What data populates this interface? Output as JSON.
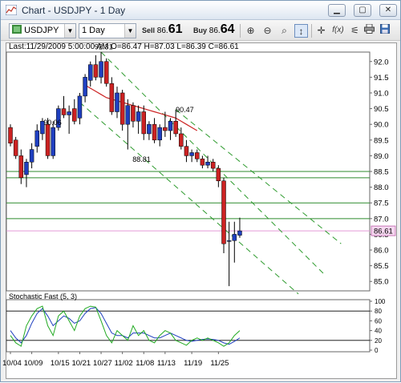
{
  "window": {
    "title": "Chart - USDJPY - 1 Day",
    "controls": [
      "minimize",
      "maximize",
      "close"
    ]
  },
  "toolbar": {
    "symbol": "USDJPY",
    "period": "1 Day",
    "sell_label": "Sell",
    "sell_small": "86.",
    "sell_big": "61",
    "buy_label": "Buy",
    "buy_small": "86.",
    "buy_big": "64",
    "tools": [
      "zoom-in-icon",
      "zoom-out-icon",
      "zoom-area-icon",
      "zoom-reset-icon",
      "cursor-tool-icon",
      "crosshair-icon",
      "fx-icon",
      "indicator-icon",
      "print-icon",
      "save-icon"
    ]
  },
  "chart_header": {
    "last_line": "Last:11/29/2009 5:00:00 AM O=86.47 H=87.03 L=86.39 C=86.61"
  },
  "stochastic": {
    "label": "Stochastic Fast (5, 3)",
    "ticks": [
      "100",
      "80",
      "60",
      "40",
      "20",
      "0"
    ]
  },
  "chart_data": {
    "type": "candlestick",
    "ylim": [
      84.7,
      92.3
    ],
    "y_ticks": [
      "92.0",
      "91.5",
      "91.0",
      "90.5",
      "90.0",
      "89.5",
      "89.0",
      "88.5",
      "88.0",
      "87.5",
      "87.0",
      "86.5",
      "86.0",
      "85.5",
      "85.0"
    ],
    "x_ticks": [
      "10/04",
      "10/09",
      "10/15",
      "10/21",
      "10/27",
      "11/02",
      "11/08",
      "11/13",
      "11/19",
      "11/25"
    ],
    "current_price": "86.61",
    "annotations": [
      "92.31",
      "90.06",
      "90.47",
      "88.81"
    ],
    "horizontal_lines": [
      88.5,
      88.3,
      87.5,
      87.0
    ],
    "candles": [
      {
        "o": 89.9,
        "h": 90.0,
        "l": 89.3,
        "c": 89.4
      },
      {
        "o": 89.5,
        "h": 89.6,
        "l": 88.9,
        "c": 89.0
      },
      {
        "o": 89.0,
        "h": 89.2,
        "l": 88.1,
        "c": 88.3
      },
      {
        "o": 88.4,
        "h": 88.9,
        "l": 88.0,
        "c": 88.8
      },
      {
        "o": 88.8,
        "h": 89.4,
        "l": 88.6,
        "c": 89.2
      },
      {
        "o": 89.3,
        "h": 90.0,
        "l": 89.1,
        "c": 89.8
      },
      {
        "o": 89.7,
        "h": 90.2,
        "l": 89.5,
        "c": 90.1
      },
      {
        "o": 90.0,
        "h": 90.2,
        "l": 88.9,
        "c": 89.0
      },
      {
        "o": 89.0,
        "h": 90.1,
        "l": 88.9,
        "c": 89.9
      },
      {
        "o": 89.9,
        "h": 90.6,
        "l": 89.8,
        "c": 90.5
      },
      {
        "o": 90.5,
        "h": 90.9,
        "l": 90.2,
        "c": 90.3
      },
      {
        "o": 90.3,
        "h": 90.6,
        "l": 89.7,
        "c": 90.4
      },
      {
        "o": 90.5,
        "h": 90.8,
        "l": 90.0,
        "c": 90.1
      },
      {
        "o": 90.2,
        "h": 91.0,
        "l": 90.0,
        "c": 90.9
      },
      {
        "o": 90.9,
        "h": 91.6,
        "l": 90.7,
        "c": 91.5
      },
      {
        "o": 91.4,
        "h": 92.0,
        "l": 91.2,
        "c": 91.9
      },
      {
        "o": 91.9,
        "h": 92.2,
        "l": 91.4,
        "c": 91.5
      },
      {
        "o": 91.5,
        "h": 92.3,
        "l": 91.3,
        "c": 92.0
      },
      {
        "o": 92.0,
        "h": 92.1,
        "l": 91.2,
        "c": 91.3
      },
      {
        "o": 91.3,
        "h": 91.5,
        "l": 90.3,
        "c": 90.4
      },
      {
        "o": 90.4,
        "h": 91.2,
        "l": 90.2,
        "c": 91.0
      },
      {
        "o": 91.0,
        "h": 91.1,
        "l": 89.8,
        "c": 90.0
      },
      {
        "o": 90.0,
        "h": 90.8,
        "l": 89.2,
        "c": 90.6
      },
      {
        "o": 90.6,
        "h": 90.7,
        "l": 89.9,
        "c": 90.1
      },
      {
        "o": 90.1,
        "h": 90.6,
        "l": 89.7,
        "c": 90.4
      },
      {
        "o": 90.4,
        "h": 90.6,
        "l": 89.5,
        "c": 89.7
      },
      {
        "o": 89.7,
        "h": 90.1,
        "l": 89.5,
        "c": 90.0
      },
      {
        "o": 90.0,
        "h": 90.2,
        "l": 89.4,
        "c": 89.5
      },
      {
        "o": 89.5,
        "h": 90.0,
        "l": 89.3,
        "c": 89.9
      },
      {
        "o": 89.9,
        "h": 90.4,
        "l": 89.6,
        "c": 89.8
      },
      {
        "o": 89.8,
        "h": 90.2,
        "l": 89.5,
        "c": 90.1
      },
      {
        "o": 90.1,
        "h": 90.47,
        "l": 89.6,
        "c": 89.7
      },
      {
        "o": 89.7,
        "h": 89.9,
        "l": 89.2,
        "c": 89.3
      },
      {
        "o": 89.3,
        "h": 89.5,
        "l": 88.8,
        "c": 89.0
      },
      {
        "o": 89.0,
        "h": 89.2,
        "l": 88.8,
        "c": 89.1
      },
      {
        "o": 89.1,
        "h": 89.2,
        "l": 88.8,
        "c": 88.9
      },
      {
        "o": 88.9,
        "h": 89.0,
        "l": 88.6,
        "c": 88.7
      },
      {
        "o": 88.7,
        "h": 89.0,
        "l": 88.6,
        "c": 88.8
      },
      {
        "o": 88.8,
        "h": 88.9,
        "l": 88.5,
        "c": 88.6
      },
      {
        "o": 88.6,
        "h": 88.7,
        "l": 88.0,
        "c": 88.2
      },
      {
        "o": 88.2,
        "h": 88.3,
        "l": 85.9,
        "c": 86.2
      },
      {
        "o": 86.3,
        "h": 86.9,
        "l": 84.85,
        "c": 86.3
      },
      {
        "o": 86.3,
        "h": 86.9,
        "l": 85.6,
        "c": 86.5
      },
      {
        "o": 86.47,
        "h": 87.03,
        "l": 86.39,
        "c": 86.61
      }
    ],
    "moving_average": {
      "start_index": 14,
      "values": [
        91.25,
        91.15,
        91.05,
        90.95,
        90.85,
        90.8,
        90.75,
        90.7,
        90.65,
        90.6,
        90.55,
        90.5,
        90.45,
        90.4,
        90.35,
        90.3,
        90.25,
        90.2,
        90.1,
        90.0,
        89.9,
        89.8
      ]
    },
    "stoch_k": [
      30,
      15,
      8,
      50,
      70,
      85,
      90,
      50,
      30,
      70,
      80,
      60,
      40,
      70,
      85,
      90,
      88,
      60,
      30,
      15,
      40,
      30,
      20,
      50,
      30,
      40,
      20,
      15,
      30,
      40,
      35,
      20,
      15,
      10,
      20,
      25,
      20,
      25,
      20,
      15,
      8,
      15,
      30,
      40
    ],
    "stoch_d": [
      40,
      25,
      15,
      30,
      55,
      75,
      85,
      70,
      50,
      60,
      70,
      65,
      55,
      60,
      75,
      85,
      87,
      75,
      55,
      35,
      30,
      30,
      25,
      35,
      35,
      35,
      30,
      25,
      25,
      30,
      35,
      30,
      25,
      20,
      18,
      20,
      22,
      23,
      22,
      20,
      15,
      12,
      18,
      25
    ]
  }
}
